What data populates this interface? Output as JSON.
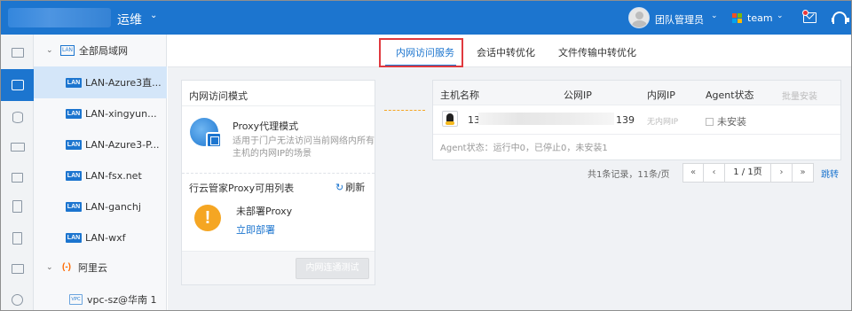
{
  "header": {
    "brand": "运维",
    "user_name": "团队管理员",
    "team_name": "team",
    "team_logo_colors": [
      "#f25022",
      "#7fba00",
      "#00a4ef",
      "#ffb900"
    ],
    "accent": "#1c75cf"
  },
  "rail": {
    "icons": [
      "monitor-icon",
      "network-icon",
      "database-icon",
      "storage-icon",
      "document-icon",
      "clipboard-icon",
      "report-icon",
      "pulse-icon",
      "settings-icon"
    ],
    "active_index": 1
  },
  "tree": {
    "root_label": "全部局域网",
    "root_badge": "LAN",
    "items": [
      {
        "badge": "LAN",
        "label": "LAN-Azure3直..."
      },
      {
        "badge": "LAN",
        "label": "LAN-xingyun..."
      },
      {
        "badge": "LAN",
        "label": "LAN-Azure3-P..."
      },
      {
        "badge": "LAN",
        "label": "LAN-fsx.net"
      },
      {
        "badge": "LAN",
        "label": "LAN-ganchj"
      },
      {
        "badge": "LAN",
        "label": "LAN-wxf"
      }
    ],
    "cloud_group_label": "阿里云",
    "cloud_badge": "(-)",
    "vpc_badge": "VPC",
    "vpc_label": "vpc-sz@华南 1"
  },
  "tabs": [
    {
      "label": "内网访问服务",
      "active": true
    },
    {
      "label": "会话中转优化",
      "active": false
    },
    {
      "label": "文件传输中转优化",
      "active": false
    }
  ],
  "left_panel": {
    "title": "内网访问模式",
    "proxy_mode_title": "Proxy代理模式",
    "proxy_mode_desc": "适用于门户无法访问当前网络内所有主机的内网IP的场景",
    "available_title": "行云管家Proxy可用列表",
    "refresh_label": "刷新",
    "no_proxy_text": "未部署Proxy",
    "deploy_link": "立即部署",
    "test_button": "内网连通测试"
  },
  "hosts_table": {
    "columns": [
      "主机名称",
      "公网IP",
      "内网IP",
      "Agent状态",
      "批量安装"
    ],
    "rows": [
      {
        "host_prefix": "13",
        "public_ip_suffix": "139",
        "private_ip": "无内网IP",
        "agent_status": "未安装"
      }
    ],
    "agent_summary": "Agent状态：运行中0，已停止0，未安装1"
  },
  "pagination": {
    "summary": "共1条记录，11条/页",
    "first": "«",
    "prev": "‹",
    "page_display": "1 / 1页",
    "next": "›",
    "last": "»",
    "jump_label": "跳转"
  }
}
